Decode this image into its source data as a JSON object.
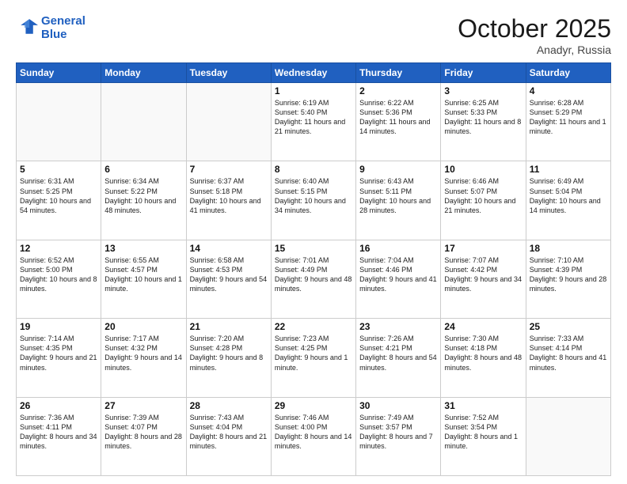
{
  "logo": {
    "line1": "General",
    "line2": "Blue"
  },
  "header": {
    "month": "October 2025",
    "location": "Anadyr, Russia"
  },
  "weekdays": [
    "Sunday",
    "Monday",
    "Tuesday",
    "Wednesday",
    "Thursday",
    "Friday",
    "Saturday"
  ],
  "weeks": [
    [
      {
        "day": "",
        "sunrise": "",
        "sunset": "",
        "daylight": ""
      },
      {
        "day": "",
        "sunrise": "",
        "sunset": "",
        "daylight": ""
      },
      {
        "day": "",
        "sunrise": "",
        "sunset": "",
        "daylight": ""
      },
      {
        "day": "1",
        "sunrise": "Sunrise: 6:19 AM",
        "sunset": "Sunset: 5:40 PM",
        "daylight": "Daylight: 11 hours and 21 minutes."
      },
      {
        "day": "2",
        "sunrise": "Sunrise: 6:22 AM",
        "sunset": "Sunset: 5:36 PM",
        "daylight": "Daylight: 11 hours and 14 minutes."
      },
      {
        "day": "3",
        "sunrise": "Sunrise: 6:25 AM",
        "sunset": "Sunset: 5:33 PM",
        "daylight": "Daylight: 11 hours and 8 minutes."
      },
      {
        "day": "4",
        "sunrise": "Sunrise: 6:28 AM",
        "sunset": "Sunset: 5:29 PM",
        "daylight": "Daylight: 11 hours and 1 minute."
      }
    ],
    [
      {
        "day": "5",
        "sunrise": "Sunrise: 6:31 AM",
        "sunset": "Sunset: 5:25 PM",
        "daylight": "Daylight: 10 hours and 54 minutes."
      },
      {
        "day": "6",
        "sunrise": "Sunrise: 6:34 AM",
        "sunset": "Sunset: 5:22 PM",
        "daylight": "Daylight: 10 hours and 48 minutes."
      },
      {
        "day": "7",
        "sunrise": "Sunrise: 6:37 AM",
        "sunset": "Sunset: 5:18 PM",
        "daylight": "Daylight: 10 hours and 41 minutes."
      },
      {
        "day": "8",
        "sunrise": "Sunrise: 6:40 AM",
        "sunset": "Sunset: 5:15 PM",
        "daylight": "Daylight: 10 hours and 34 minutes."
      },
      {
        "day": "9",
        "sunrise": "Sunrise: 6:43 AM",
        "sunset": "Sunset: 5:11 PM",
        "daylight": "Daylight: 10 hours and 28 minutes."
      },
      {
        "day": "10",
        "sunrise": "Sunrise: 6:46 AM",
        "sunset": "Sunset: 5:07 PM",
        "daylight": "Daylight: 10 hours and 21 minutes."
      },
      {
        "day": "11",
        "sunrise": "Sunrise: 6:49 AM",
        "sunset": "Sunset: 5:04 PM",
        "daylight": "Daylight: 10 hours and 14 minutes."
      }
    ],
    [
      {
        "day": "12",
        "sunrise": "Sunrise: 6:52 AM",
        "sunset": "Sunset: 5:00 PM",
        "daylight": "Daylight: 10 hours and 8 minutes."
      },
      {
        "day": "13",
        "sunrise": "Sunrise: 6:55 AM",
        "sunset": "Sunset: 4:57 PM",
        "daylight": "Daylight: 10 hours and 1 minute."
      },
      {
        "day": "14",
        "sunrise": "Sunrise: 6:58 AM",
        "sunset": "Sunset: 4:53 PM",
        "daylight": "Daylight: 9 hours and 54 minutes."
      },
      {
        "day": "15",
        "sunrise": "Sunrise: 7:01 AM",
        "sunset": "Sunset: 4:49 PM",
        "daylight": "Daylight: 9 hours and 48 minutes."
      },
      {
        "day": "16",
        "sunrise": "Sunrise: 7:04 AM",
        "sunset": "Sunset: 4:46 PM",
        "daylight": "Daylight: 9 hours and 41 minutes."
      },
      {
        "day": "17",
        "sunrise": "Sunrise: 7:07 AM",
        "sunset": "Sunset: 4:42 PM",
        "daylight": "Daylight: 9 hours and 34 minutes."
      },
      {
        "day": "18",
        "sunrise": "Sunrise: 7:10 AM",
        "sunset": "Sunset: 4:39 PM",
        "daylight": "Daylight: 9 hours and 28 minutes."
      }
    ],
    [
      {
        "day": "19",
        "sunrise": "Sunrise: 7:14 AM",
        "sunset": "Sunset: 4:35 PM",
        "daylight": "Daylight: 9 hours and 21 minutes."
      },
      {
        "day": "20",
        "sunrise": "Sunrise: 7:17 AM",
        "sunset": "Sunset: 4:32 PM",
        "daylight": "Daylight: 9 hours and 14 minutes."
      },
      {
        "day": "21",
        "sunrise": "Sunrise: 7:20 AM",
        "sunset": "Sunset: 4:28 PM",
        "daylight": "Daylight: 9 hours and 8 minutes."
      },
      {
        "day": "22",
        "sunrise": "Sunrise: 7:23 AM",
        "sunset": "Sunset: 4:25 PM",
        "daylight": "Daylight: 9 hours and 1 minute."
      },
      {
        "day": "23",
        "sunrise": "Sunrise: 7:26 AM",
        "sunset": "Sunset: 4:21 PM",
        "daylight": "Daylight: 8 hours and 54 minutes."
      },
      {
        "day": "24",
        "sunrise": "Sunrise: 7:30 AM",
        "sunset": "Sunset: 4:18 PM",
        "daylight": "Daylight: 8 hours and 48 minutes."
      },
      {
        "day": "25",
        "sunrise": "Sunrise: 7:33 AM",
        "sunset": "Sunset: 4:14 PM",
        "daylight": "Daylight: 8 hours and 41 minutes."
      }
    ],
    [
      {
        "day": "26",
        "sunrise": "Sunrise: 7:36 AM",
        "sunset": "Sunset: 4:11 PM",
        "daylight": "Daylight: 8 hours and 34 minutes."
      },
      {
        "day": "27",
        "sunrise": "Sunrise: 7:39 AM",
        "sunset": "Sunset: 4:07 PM",
        "daylight": "Daylight: 8 hours and 28 minutes."
      },
      {
        "day": "28",
        "sunrise": "Sunrise: 7:43 AM",
        "sunset": "Sunset: 4:04 PM",
        "daylight": "Daylight: 8 hours and 21 minutes."
      },
      {
        "day": "29",
        "sunrise": "Sunrise: 7:46 AM",
        "sunset": "Sunset: 4:00 PM",
        "daylight": "Daylight: 8 hours and 14 minutes."
      },
      {
        "day": "30",
        "sunrise": "Sunrise: 7:49 AM",
        "sunset": "Sunset: 3:57 PM",
        "daylight": "Daylight: 8 hours and 7 minutes."
      },
      {
        "day": "31",
        "sunrise": "Sunrise: 7:52 AM",
        "sunset": "Sunset: 3:54 PM",
        "daylight": "Daylight: 8 hours and 1 minute."
      },
      {
        "day": "",
        "sunrise": "",
        "sunset": "",
        "daylight": ""
      }
    ]
  ]
}
